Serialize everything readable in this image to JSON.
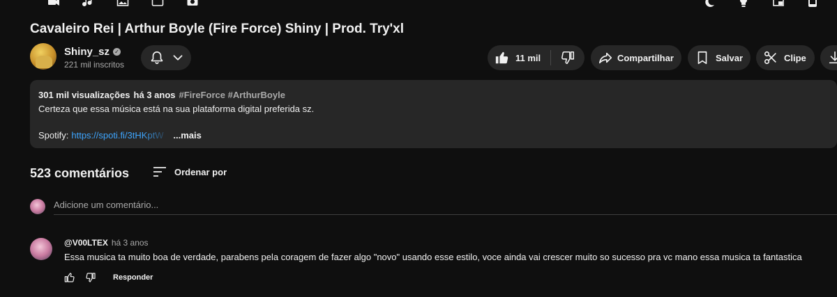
{
  "video": {
    "title": "Cavaleiro Rei | Arthur Boyle (Fire Force) Shiny | Prod. Try'xl"
  },
  "channel": {
    "name": "Shiny_sz",
    "verified_icon": "verified-badge-icon",
    "subscribers": "221 mil inscritos"
  },
  "actions": {
    "likes": "11 mil",
    "share_label": "Compartilhar",
    "save_label": "Salvar",
    "clip_label": "Clipe"
  },
  "description": {
    "views": "301 mil visualizações",
    "age": "há 3 anos",
    "tags": "#FireForce #ArthurBoyle",
    "line1": "Certeza que essa música está na sua plataforma digital preferida sz.",
    "spotify_label": "Spotify:",
    "spotify_link": "https://spoti.fi/3tHKptW",
    "more_label": "...mais"
  },
  "comments": {
    "count": "523 comentários",
    "sort_label": "Ordenar por",
    "add_placeholder": "Adicione um comentário...",
    "items": [
      {
        "author": "@V00LTEX",
        "time": "há 3 anos",
        "text": "Essa musica ta muito boa de verdade, parabens pela coragem de fazer algo \"novo\" usando esse estilo, voce ainda vai crescer muito so sucesso pra vc mano essa musica ta fantastica",
        "reply_label": "Responder"
      }
    ]
  },
  "colors": {
    "background": "#0f0f0f",
    "pill": "#272727",
    "link": "#3ea6ff",
    "muted": "#aaaaaa"
  }
}
